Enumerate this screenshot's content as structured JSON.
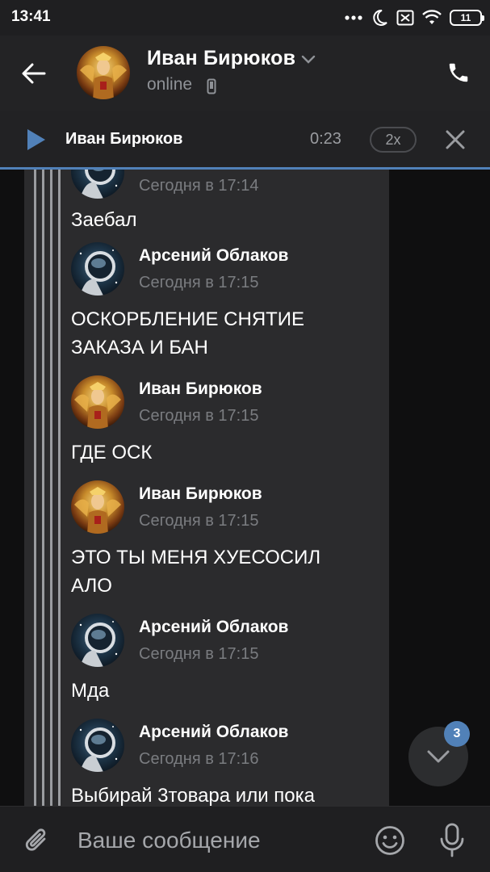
{
  "status_bar": {
    "time": "13:41",
    "battery": "11"
  },
  "header": {
    "name": "Иван Бирюков",
    "status": "online",
    "icons": {
      "back": "arrow-left-icon",
      "call": "phone-icon",
      "dropdown": "chevron-down-icon",
      "device": "mobile-device-icon"
    }
  },
  "player": {
    "title": "Иван Бирюков",
    "time": "0:23",
    "speed": "2x",
    "progress": 1.0,
    "icons": {
      "play": "play-icon",
      "close": "close-icon"
    }
  },
  "messages": [
    {
      "type": "header-partial",
      "avatar": "astronaut",
      "time": "Сегодня в 17:14"
    },
    {
      "type": "text",
      "text": "Заебал"
    },
    {
      "type": "header",
      "avatar": "astronaut",
      "name": "Арсений Облаков",
      "time": "Сегодня в 17:15"
    },
    {
      "type": "text",
      "text": "ОСКОРБЛЕНИЕ СНЯТИЕ ЗАКАЗА И БАН"
    },
    {
      "type": "header",
      "avatar": "golden",
      "name": "Иван Бирюков",
      "time": "Сегодня в 17:15"
    },
    {
      "type": "text",
      "text": "ГДЕ ОСК"
    },
    {
      "type": "header",
      "avatar": "golden",
      "name": "Иван Бирюков",
      "time": "Сегодня в 17:15"
    },
    {
      "type": "text",
      "text": "ЭТО ТЫ МЕНЯ ХУЕСОСИЛ АЛО"
    },
    {
      "type": "header",
      "avatar": "astronaut",
      "name": "Арсений Облаков",
      "time": "Сегодня в 17:15"
    },
    {
      "type": "text",
      "text": "Мда"
    },
    {
      "type": "header",
      "avatar": "astronaut",
      "name": "Арсений Облаков",
      "time": "Сегодня в 17:16"
    },
    {
      "type": "text",
      "text": "Выбирай 3товара или пока"
    }
  ],
  "scroll_fab": {
    "badge": "3",
    "icon": "chevron-down-icon"
  },
  "composer": {
    "placeholder": "Ваше сообщение",
    "icons": {
      "attach": "paperclip-icon",
      "emoji": "smiley-icon",
      "mic": "microphone-icon"
    }
  },
  "colors": {
    "accent": "#5181b8",
    "bubble": "#2b2b2d",
    "secondary_text": "#7a7c80"
  }
}
